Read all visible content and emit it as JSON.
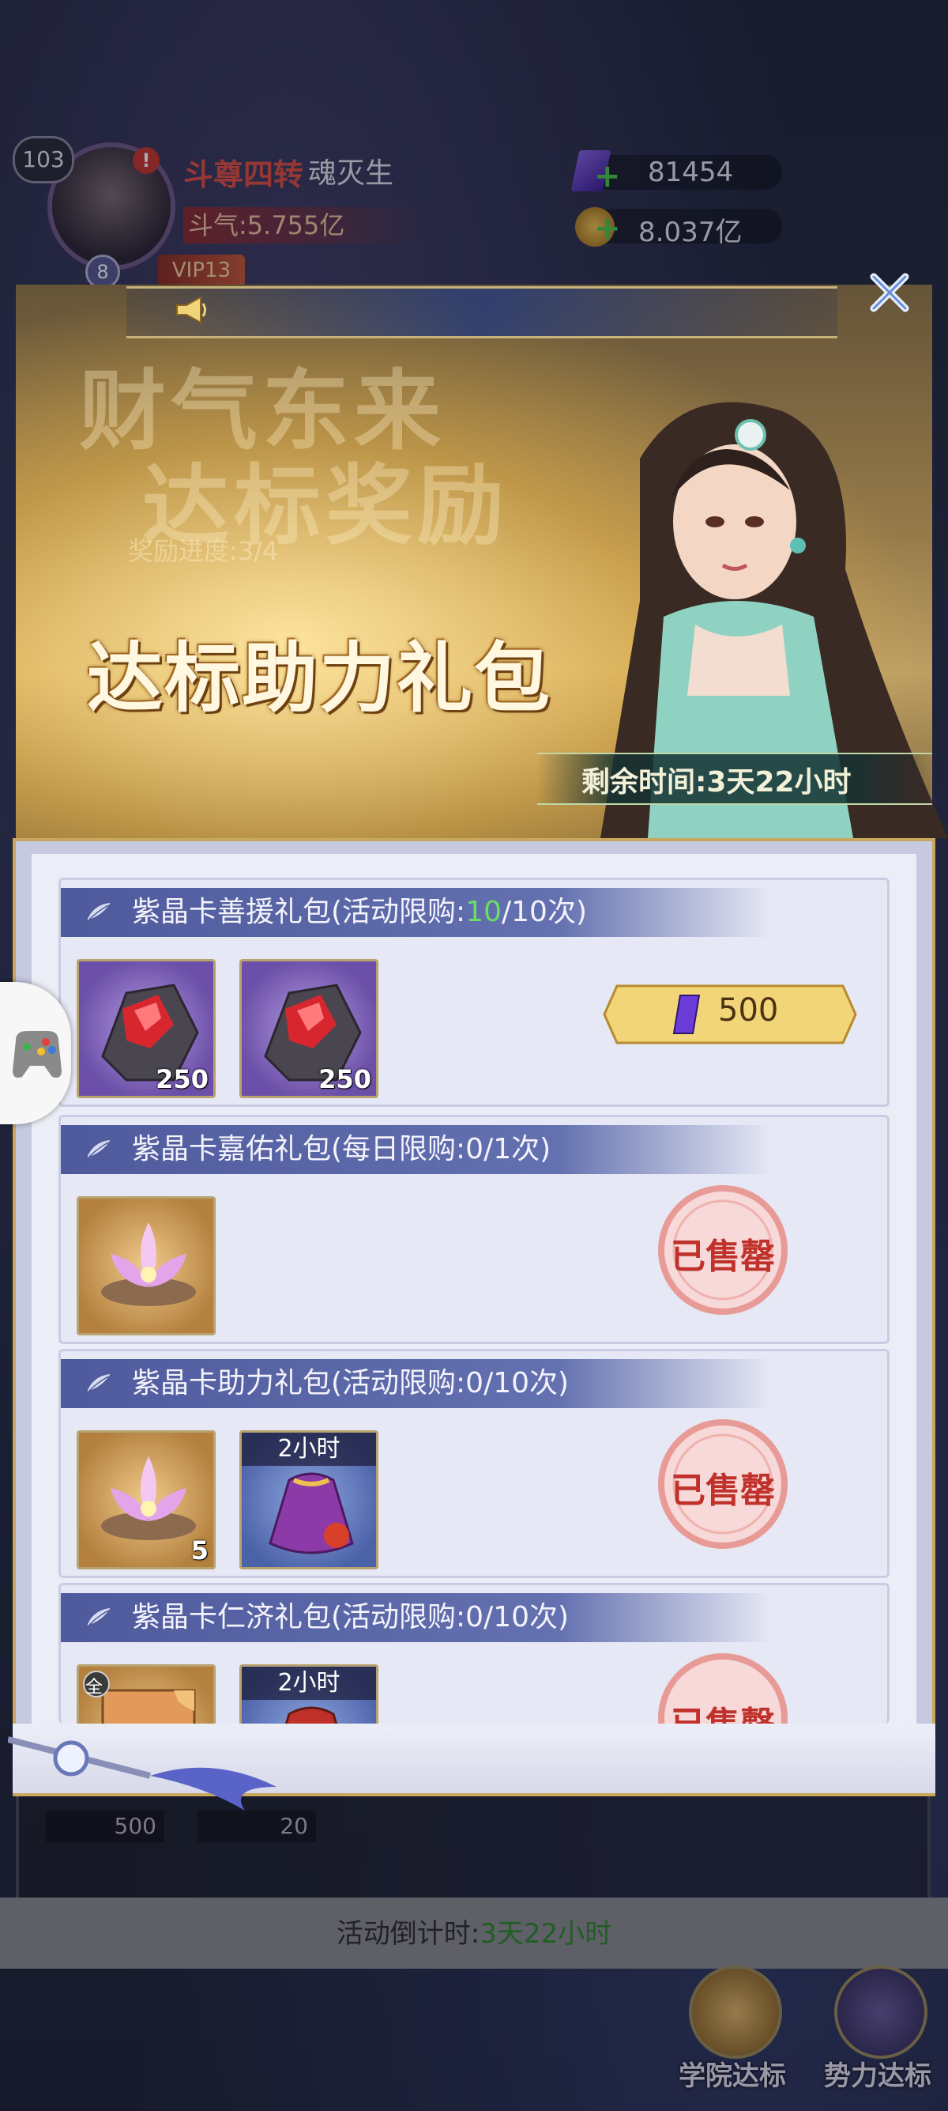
{
  "player": {
    "level": "103",
    "alert": "!",
    "sub_level": "8",
    "vip": "VIP13",
    "rank_title": "斗尊四转",
    "name": "魂灭生",
    "power": "斗气:5.755亿",
    "crystals": "81454",
    "gold": "8.037亿"
  },
  "banner": {
    "bg_text_1": "财气东来",
    "bg_text_2": "达标奖励",
    "bg_small": "奖励进度:3/4",
    "title": "达标助力礼包",
    "timer": "剩余时间:3天22小时"
  },
  "packs": [
    {
      "title_prefix": "紫晶卡善援礼包(活动限购:",
      "count_highlight": "10",
      "title_suffix": "/10次)",
      "items": [
        {
          "type": "red-crystal-ore",
          "qty": "250"
        },
        {
          "type": "red-crystal-ore",
          "qty": "250"
        }
      ],
      "price": "500",
      "status": "available"
    },
    {
      "title_prefix": "紫晶卡嘉佑礼包(每日限购:0/1次)",
      "count_highlight": "",
      "title_suffix": "",
      "items": [
        {
          "type": "lotus-flower",
          "qty": ""
        }
      ],
      "status_text": "已售罄"
    },
    {
      "title_prefix": "紫晶卡助力礼包(活动限购:0/10次)",
      "count_highlight": "",
      "title_suffix": "",
      "items": [
        {
          "type": "lotus-flower",
          "qty": "5"
        },
        {
          "type": "fortune-bag",
          "time_tag": "2小时"
        }
      ],
      "status_text": "已售罄"
    },
    {
      "title_prefix": "紫晶卡仁济礼包(活动限购:0/10次)",
      "count_highlight": "",
      "title_suffix": "",
      "items": [
        {
          "type": "puzzle-card",
          "badge": "全"
        },
        {
          "type": "fortune-bag",
          "time_tag": "2小时"
        }
      ],
      "status_text": "已售罄"
    }
  ],
  "background": {
    "item_qty_1": "500",
    "item_qty_2": "20",
    "countdown_label": "活动倒计时:",
    "countdown_value": "3天22小时",
    "nav_academy": "学院达标",
    "nav_faction": "势力达标"
  },
  "colors": {
    "header_blue": "#4e5a9c",
    "highlight_green": "#6bdc64",
    "soldout_red": "#c0312b",
    "price_gold": "#f3d579",
    "frame_gold": "#c7a85c"
  },
  "icons": [
    "close-icon",
    "horn-icon",
    "leaf-icon",
    "gamepad-icon",
    "purple-crystal-icon"
  ]
}
